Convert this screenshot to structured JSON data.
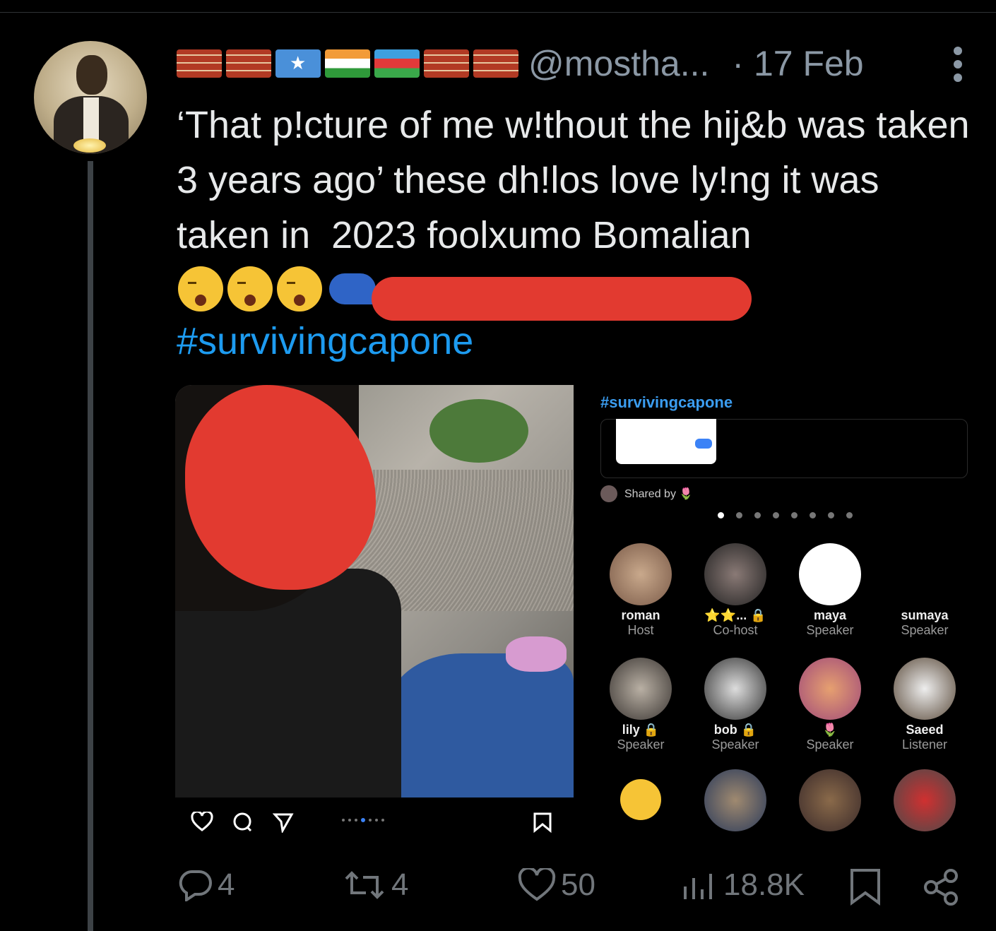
{
  "tweet": {
    "handle": "@mostha...",
    "date": "· 17 Feb",
    "text": "‘That p!cture of me w!thout the hij&b was taken  3 years ago’ these dh!los love ly!ng it was taken in  2023 foolxumo Bomalian",
    "hashtag": "#survivingcapone"
  },
  "media": {
    "right_panel": {
      "hashtag": "#survivingcapone",
      "shared_by": "Shared by 🌷",
      "page_dots": 8,
      "active_dot": 0,
      "participants": [
        {
          "name": "roman",
          "role": "Host"
        },
        {
          "name": "⭐⭐... 🔒",
          "role": "Co-host"
        },
        {
          "name": "maya",
          "role": "Speaker"
        },
        {
          "name": "sumaya",
          "role": "Speaker"
        },
        {
          "name": "lily 🔒",
          "role": "Speaker"
        },
        {
          "name": "bob 🔒",
          "role": "Speaker"
        },
        {
          "name": "🌷",
          "role": "Speaker"
        },
        {
          "name": "Saeed",
          "role": "Listener"
        }
      ]
    }
  },
  "actions": {
    "replies": "4",
    "reposts": "4",
    "likes": "50",
    "views": "18.8K"
  },
  "colors": {
    "background": "#000000",
    "link": "#1d9bf0",
    "muted": "#71767b",
    "redaction": "#e23a30"
  }
}
